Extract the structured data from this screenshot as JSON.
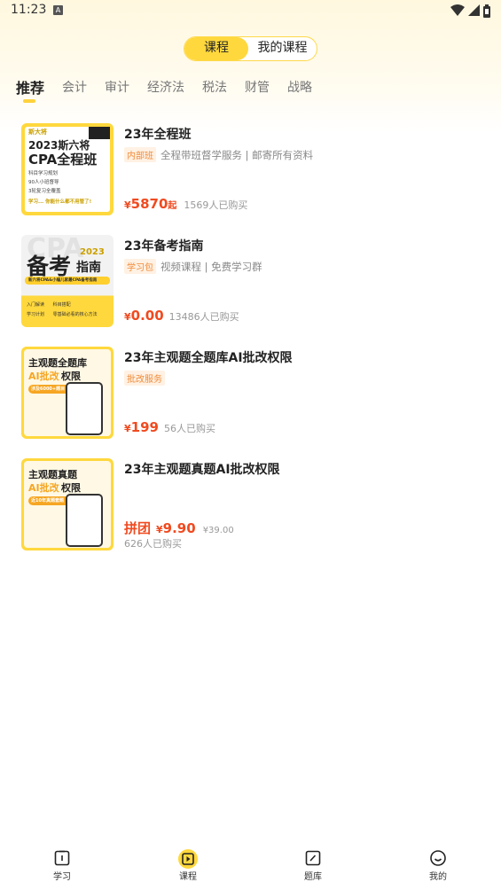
{
  "status_bar": {
    "time": "11:23",
    "notif_icon": "A"
  },
  "segment": {
    "tabs": [
      {
        "label": "课程"
      },
      {
        "label": "我的课程"
      }
    ]
  },
  "categories": [
    {
      "label": "推荐"
    },
    {
      "label": "会计"
    },
    {
      "label": "审计"
    },
    {
      "label": "经济法"
    },
    {
      "label": "税法"
    },
    {
      "label": "财管"
    },
    {
      "label": "战略"
    }
  ],
  "courses": [
    {
      "title": "23年全程班",
      "tag": "内部班",
      "subtitle": "全程带班督学服务 | 邮寄所有资料",
      "yen": "¥",
      "price": "5870",
      "price_suffix": "起",
      "sold": "1569人已购买",
      "thumb": {
        "brand": "斯大将",
        "line1": "2023斯六将",
        "line2": "CPA全程班",
        "bullets": [
          "科目学习规划",
          "90人小班督导",
          "3轮复习全覆盖"
        ],
        "footer": "学习... 你能什么都不用管了!"
      }
    },
    {
      "title": "23年备考指南",
      "tag": "学习包",
      "subtitle": "视频课程 | 免费学习群",
      "yen": "¥",
      "price": "0.00",
      "sold": "13486人已购买",
      "thumb": {
        "bg_text": "CPA",
        "line1": "备考",
        "year": "2023",
        "line2": "指南",
        "banner": "新六将CPA&小编儿家最CPA备考指南",
        "chips": [
          "入门解读",
          "科目搭配",
          "学习计划",
          "零基础必看的核心方法"
        ]
      }
    },
    {
      "title": "23年主观题全题库AI批改权限",
      "tag": "批改服务",
      "yen": "¥",
      "price": "199",
      "sold": "56人已购买",
      "thumb": {
        "line1": "主观题全题库",
        "line2a": "AI批改",
        "line2b": "权限",
        "chip": "涉及6000+题目"
      }
    },
    {
      "title": "23年主观题真题AI批改权限",
      "group_label": "拼团",
      "yen": "¥",
      "price": "9.90",
      "original_price": "¥39.00",
      "sold": "626人已购买",
      "thumb": {
        "line1": "主观题真题",
        "line2a": "AI批改",
        "line2b": "权限",
        "chip": "近10年真题套题"
      }
    }
  ],
  "bottom_nav": [
    {
      "label": "学习",
      "icon": "book-icon"
    },
    {
      "label": "课程",
      "icon": "play-icon"
    },
    {
      "label": "题库",
      "icon": "edit-icon"
    },
    {
      "label": "我的",
      "icon": "smile-icon"
    }
  ],
  "colors": {
    "accent": "#ffd83d",
    "price": "#f04a1f",
    "tag_text": "#f08c3a",
    "tag_bg": "#fff1e3"
  }
}
